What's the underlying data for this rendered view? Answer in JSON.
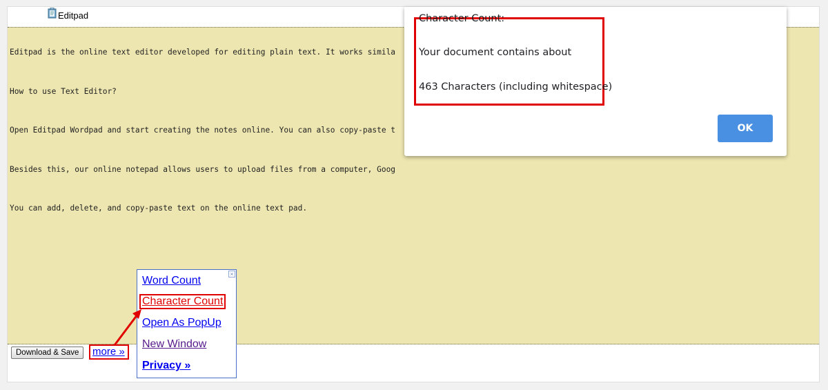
{
  "app": {
    "title": "Editpad",
    "icon": "notepad-icon"
  },
  "editor": {
    "lines": [
      "Editpad is the online text editor developed for editing plain text. It works simila",
      "How to use Text Editor?",
      "Open Editpad Wordpad and start creating the notes online. You can also copy-paste t",
      "Besides this, our online notepad allows users to upload files from a computer, Goog",
      "You can add, delete, and copy-paste text on the online text pad."
    ],
    "background": "#ede6b0"
  },
  "toolbar": {
    "download_label": "Download & Save",
    "more_label": "more »"
  },
  "more_menu": {
    "close_glyph": "×",
    "items": [
      "Word Count",
      "Character Count",
      "Open As PopUp",
      "New Window",
      "Privacy »"
    ]
  },
  "dialog": {
    "line1": "Character Count:",
    "line2": "Your document contains about",
    "line3": "463 Characters (including whitespace)",
    "ok_label": "OK"
  },
  "colors": {
    "highlight": "#e00000",
    "ok_button": "#4a90e2",
    "link": "#0000ee"
  }
}
